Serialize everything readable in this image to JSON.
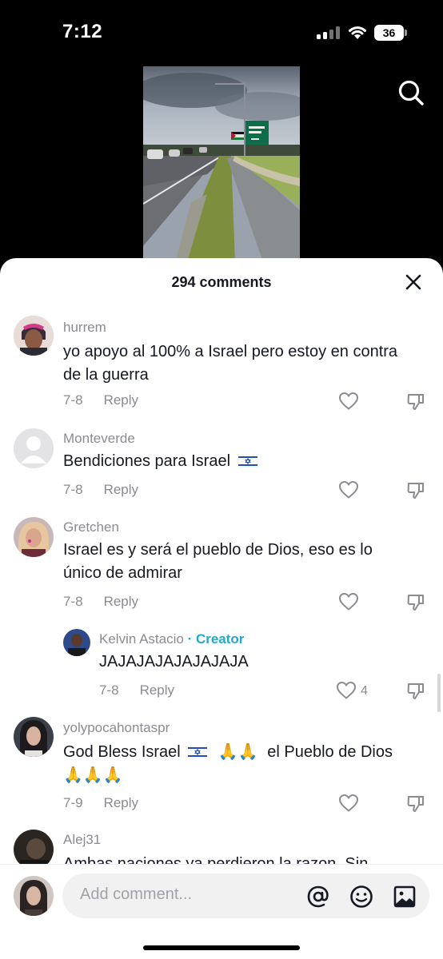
{
  "status_bar": {
    "time": "7:12",
    "battery": "36"
  },
  "sheet": {
    "title": "294 comments"
  },
  "comments": [
    {
      "username": "hurrem",
      "text": "yo apoyo al 100% a Israel pero estoy en contra de la guerra",
      "date": "7-8",
      "reply": "Reply"
    },
    {
      "username": "Monteverde",
      "text": "Bendiciones para Israel",
      "date": "7-8",
      "reply": "Reply"
    },
    {
      "username": "Gretchen",
      "text": "Israel es y será el pueblo de Dios, eso es lo único de admirar",
      "date": "7-8",
      "reply": "Reply"
    },
    {
      "username": "Kelvin Astacio",
      "creator_label": "· Creator",
      "text": "JAJAJAJAJAJAJAJA",
      "date": "7-8",
      "reply": "Reply",
      "likes": "4"
    },
    {
      "username": "yolypocahontaspr",
      "text_a": "God Bless Israel",
      "text_b": "el Pueblo de Dios",
      "date": "7-9",
      "reply": "Reply"
    },
    {
      "username": "Alej31",
      "text": "Ambas naciones ya perdieron la razon. Sin"
    }
  ],
  "composer": {
    "placeholder": "Add comment..."
  },
  "icons": {
    "search": "search-icon",
    "close": "close-icon",
    "like": "heart-icon",
    "dislike": "thumbs-down-icon",
    "mention": "at-sign-icon",
    "emoji": "emoji-icon",
    "image": "image-icon"
  },
  "colors": {
    "creator": "#20a9c8",
    "meta": "#8a8b91",
    "text": "#161823"
  }
}
